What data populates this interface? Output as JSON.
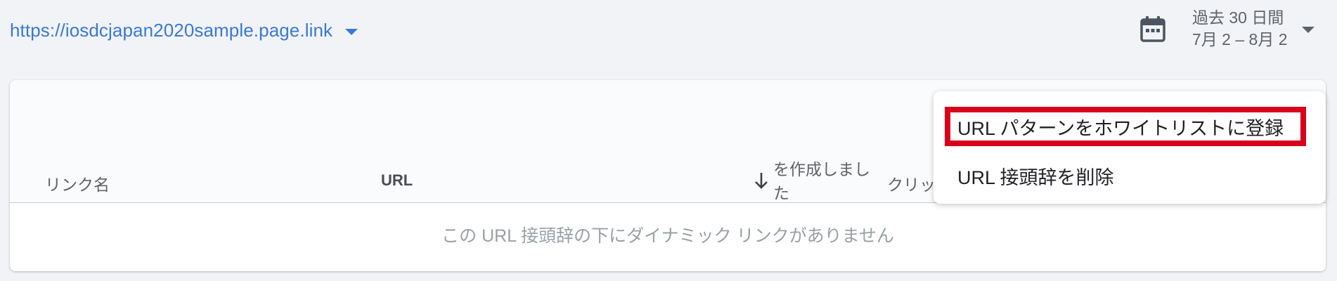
{
  "header": {
    "domain": "https://iosdcjapan2020sample.page.link",
    "date_range_label": "過去 30 日間",
    "date_range_value": "7月 2 – 8月 2",
    "icons": {
      "domain_dropdown": "caret-down-icon",
      "calendar": "calendar-icon",
      "date_dropdown": "caret-down-icon"
    }
  },
  "table": {
    "columns": [
      {
        "label": "リンク名"
      },
      {
        "label": "URL"
      },
      {
        "label": "を作成しました",
        "sort_icon": "arrow-down-icon"
      },
      {
        "label": "クリッ"
      }
    ],
    "empty_message": "この URL 接頭辞の下にダイナミック リンクがありません"
  },
  "menu": {
    "items": [
      {
        "label": "URL パターンをホワイトリストに登録",
        "highlighted": true
      },
      {
        "label": "URL 接頭辞を削除",
        "highlighted": false
      }
    ]
  },
  "colors": {
    "link": "#3a79d6",
    "highlight_border": "#d9001b",
    "background": "#f1f3f6"
  }
}
